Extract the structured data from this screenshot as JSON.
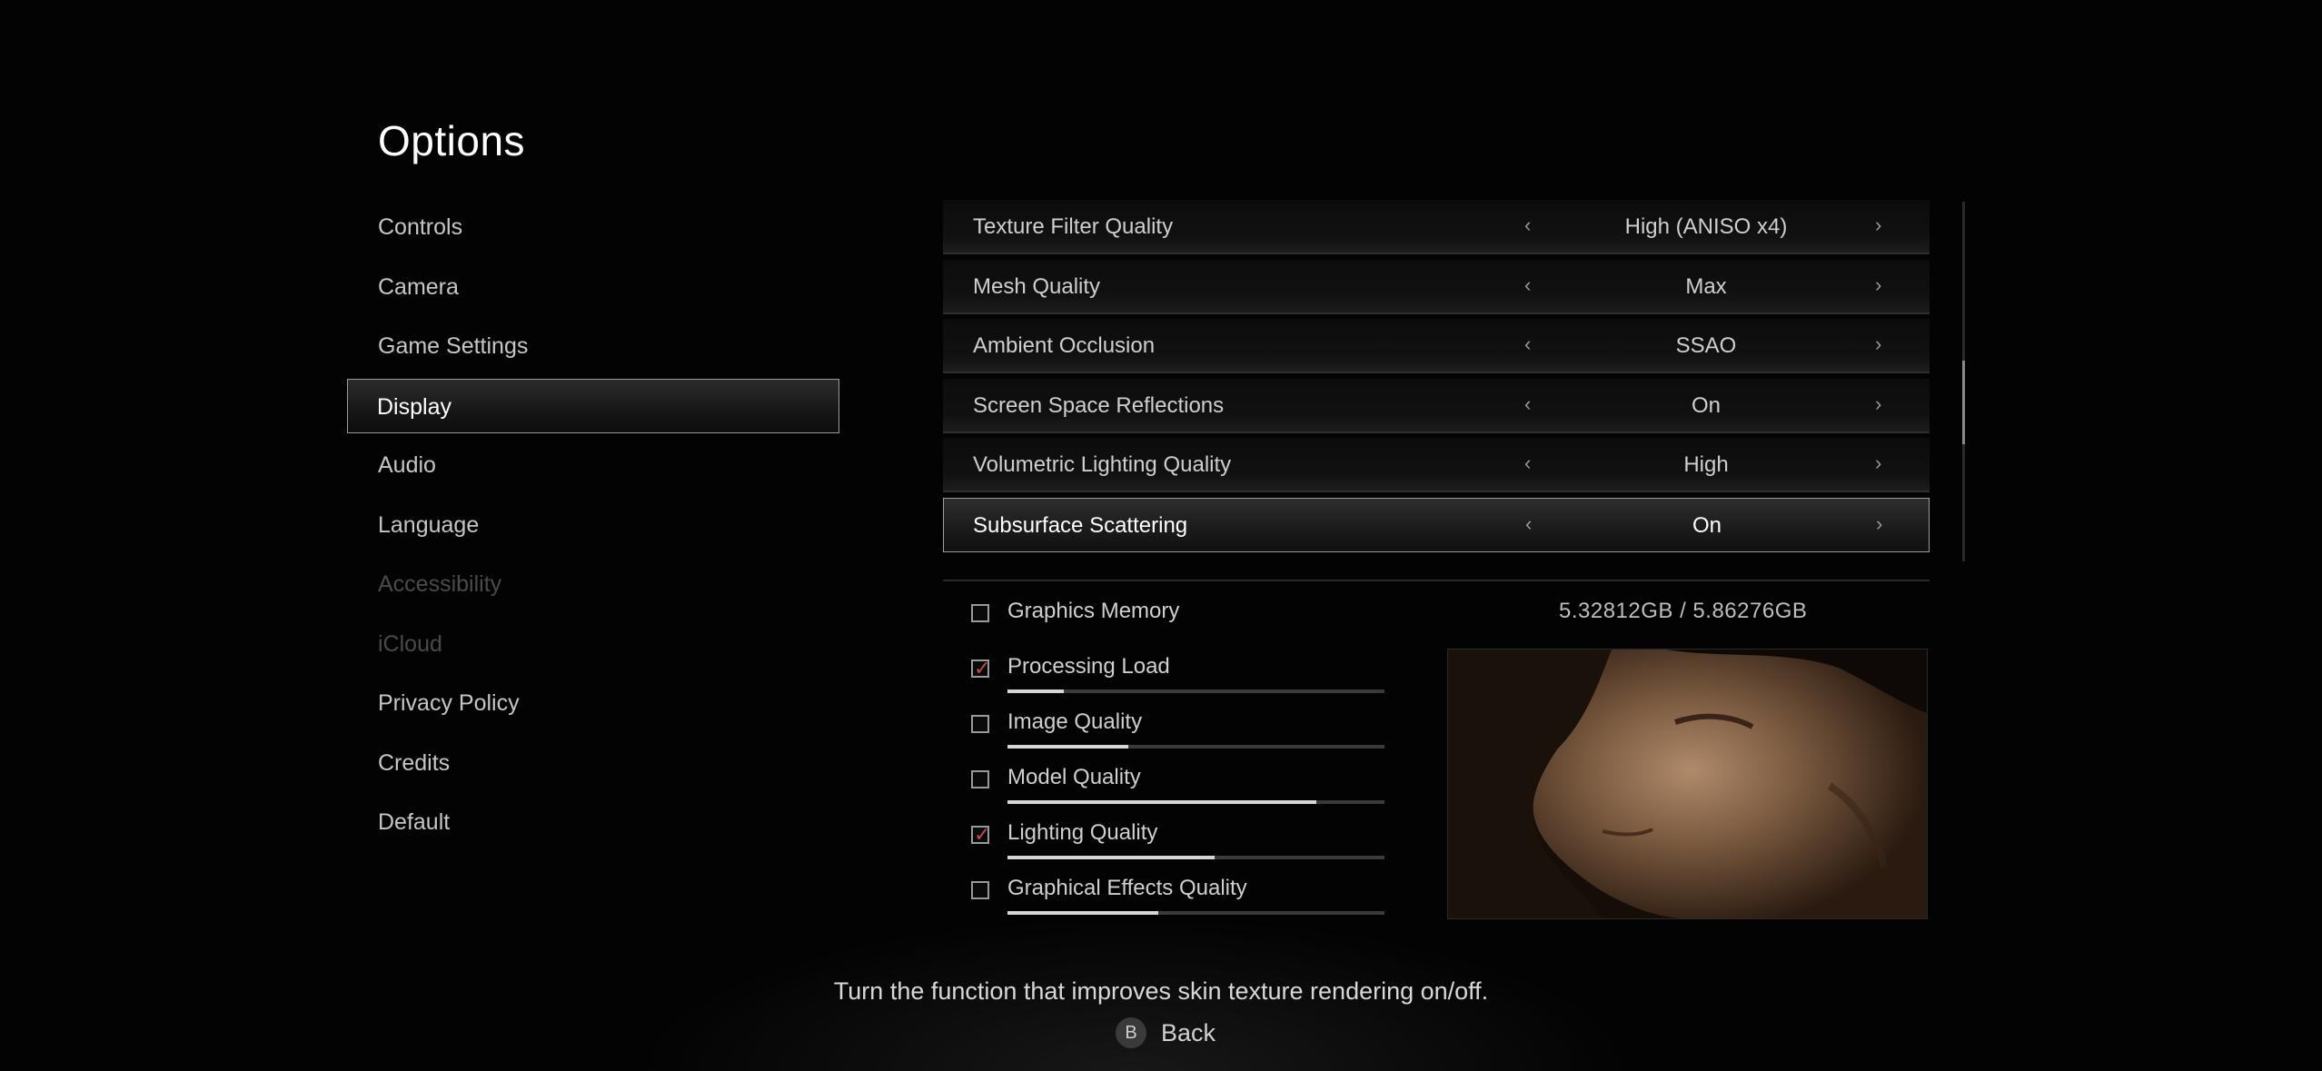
{
  "title": "Options",
  "sidebar": {
    "items": [
      {
        "label": "Controls",
        "state": "normal"
      },
      {
        "label": "Camera",
        "state": "normal"
      },
      {
        "label": "Game Settings",
        "state": "normal"
      },
      {
        "label": "Display",
        "state": "selected"
      },
      {
        "label": "Audio",
        "state": "normal"
      },
      {
        "label": "Language",
        "state": "normal"
      },
      {
        "label": "Accessibility",
        "state": "disabled"
      },
      {
        "label": "iCloud",
        "state": "disabled"
      },
      {
        "label": "Privacy Policy",
        "state": "normal"
      },
      {
        "label": "Credits",
        "state": "normal"
      },
      {
        "label": "Default",
        "state": "normal"
      }
    ]
  },
  "settings": [
    {
      "label": "Texture Filter Quality",
      "value": "High (ANISO x4)"
    },
    {
      "label": "Mesh Quality",
      "value": "Max"
    },
    {
      "label": "Ambient Occlusion",
      "value": "SSAO"
    },
    {
      "label": "Screen Space Reflections",
      "value": "On"
    },
    {
      "label": "Volumetric Lighting Quality",
      "value": "High"
    },
    {
      "label": "Subsurface Scattering",
      "value": "On",
      "selected": true
    }
  ],
  "arrows": {
    "left": "‹",
    "right": "›"
  },
  "graphics_memory": {
    "label": "Graphics Memory",
    "value": "5.32812GB  /  5.86276GB",
    "checked": false
  },
  "metrics": [
    {
      "label": "Processing Load",
      "checked": true,
      "level": 0.15
    },
    {
      "label": "Image Quality",
      "checked": false,
      "level": 0.32
    },
    {
      "label": "Model Quality",
      "checked": false,
      "level": 0.82
    },
    {
      "label": "Lighting Quality",
      "checked": true,
      "level": 0.55
    },
    {
      "label": "Graphical Effects Quality",
      "checked": false,
      "level": 0.4
    }
  ],
  "check_glyph": "✓",
  "footer": {
    "hint": "Turn the function that improves skin texture rendering on/off.",
    "back_button_glyph": "B",
    "back_label": "Back"
  },
  "colors": {
    "background": "#030303",
    "check": "#c24a4a",
    "selected_border": "#9b9b9b"
  }
}
